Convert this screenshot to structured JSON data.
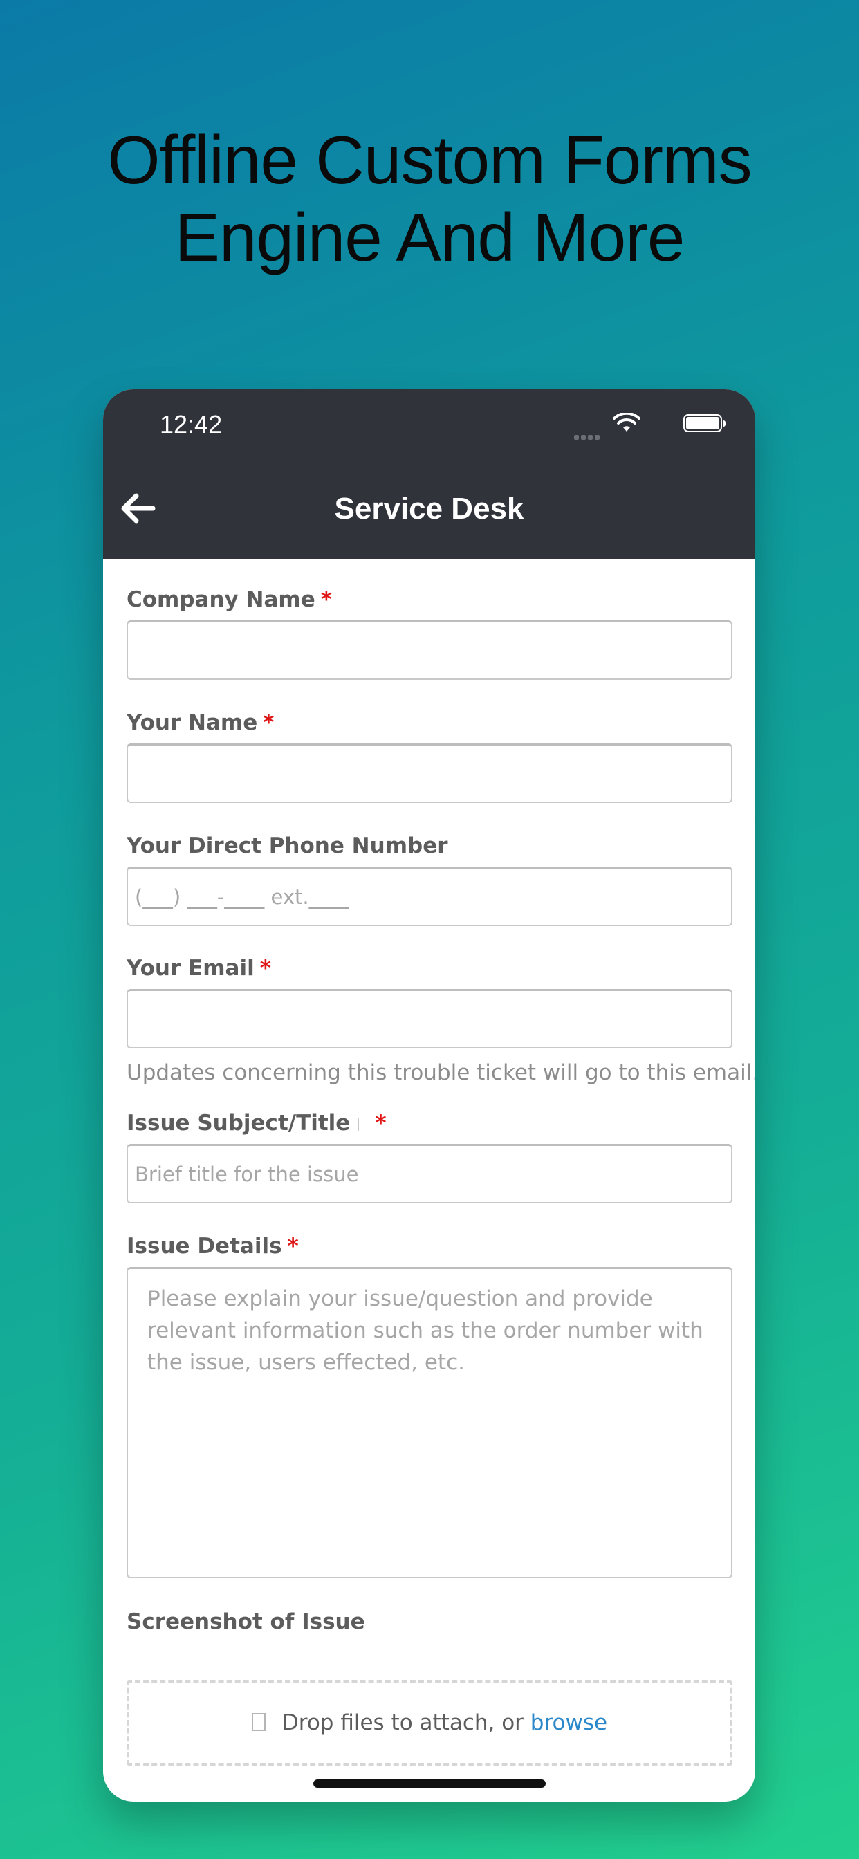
{
  "headline": {
    "line1": "Offline Custom Forms",
    "line2": "Engine And More"
  },
  "status_bar": {
    "time": "12:42",
    "icons": [
      "cellular-signal-icon",
      "wifi-icon",
      "battery-icon"
    ]
  },
  "nav": {
    "title": "Service Desk",
    "back_icon": "arrow-left-icon"
  },
  "form": {
    "company_name": {
      "label": "Company Name",
      "required": "*",
      "value": ""
    },
    "your_name": {
      "label": "Your Name",
      "required": "*",
      "value": ""
    },
    "phone": {
      "label": "Your Direct Phone Number",
      "placeholder": "(___) ___-____         ext.____"
    },
    "email": {
      "label": "Your Email",
      "required": "*",
      "value": "",
      "hint": "Updates concerning this trouble ticket will go to this email."
    },
    "subject": {
      "label": "Issue Subject/Title",
      "required": "*",
      "placeholder": "Brief title for the issue"
    },
    "details": {
      "label": "Issue Details",
      "required": "*",
      "placeholder": "Please explain your issue/question and provide relevant information such as the order number with the issue, users effected, etc."
    },
    "screenshot": {
      "label": "Screenshot of Issue",
      "drop_text": "Drop files to attach, or",
      "browse_text": "browse"
    }
  },
  "colors": {
    "top_bar": "#30333a",
    "required": "#e01616",
    "link": "#2a87c9",
    "label": "#5c5c5c",
    "background_gradient_start": "#0b7aa7",
    "background_gradient_end": "#22cf8e"
  }
}
